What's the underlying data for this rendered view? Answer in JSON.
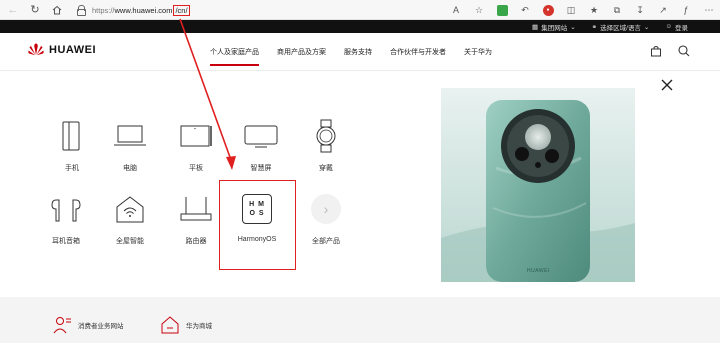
{
  "browser": {
    "url_proto": "https://",
    "url_host": "www.huawei.com",
    "url_path": "/cn/",
    "read_aloud": "A"
  },
  "topbar": {
    "items": [
      "集团网站",
      "选择区域/语言",
      "登录"
    ]
  },
  "header": {
    "brand": "HUAWEI",
    "nav": [
      "个人及家庭产品",
      "商用产品及方案",
      "服务支持",
      "合作伙伴与开发者",
      "关于华为"
    ]
  },
  "products": {
    "tiles": [
      {
        "label": "手机"
      },
      {
        "label": "电脑"
      },
      {
        "label": "平板"
      },
      {
        "label": "智慧屏"
      },
      {
        "label": "穿戴"
      },
      {
        "label": "耳机音箱"
      },
      {
        "label": "全屋智能"
      },
      {
        "label": "路由器"
      },
      {
        "label": "HarmonyOS"
      },
      {
        "label": "全部产品"
      }
    ],
    "harmony_logo": [
      "H M",
      "O S"
    ]
  },
  "promo": {
    "phone_brand": "HUAWEI"
  },
  "footer": {
    "links": [
      "消费者业务网站",
      "华为商城"
    ]
  },
  "colors": {
    "accent": "#c7000b",
    "annotation_red": "#e02020",
    "topbar_bg": "#111111",
    "footer_bg": "#f4f4f4",
    "promo_teal": "#7fb8ae"
  }
}
